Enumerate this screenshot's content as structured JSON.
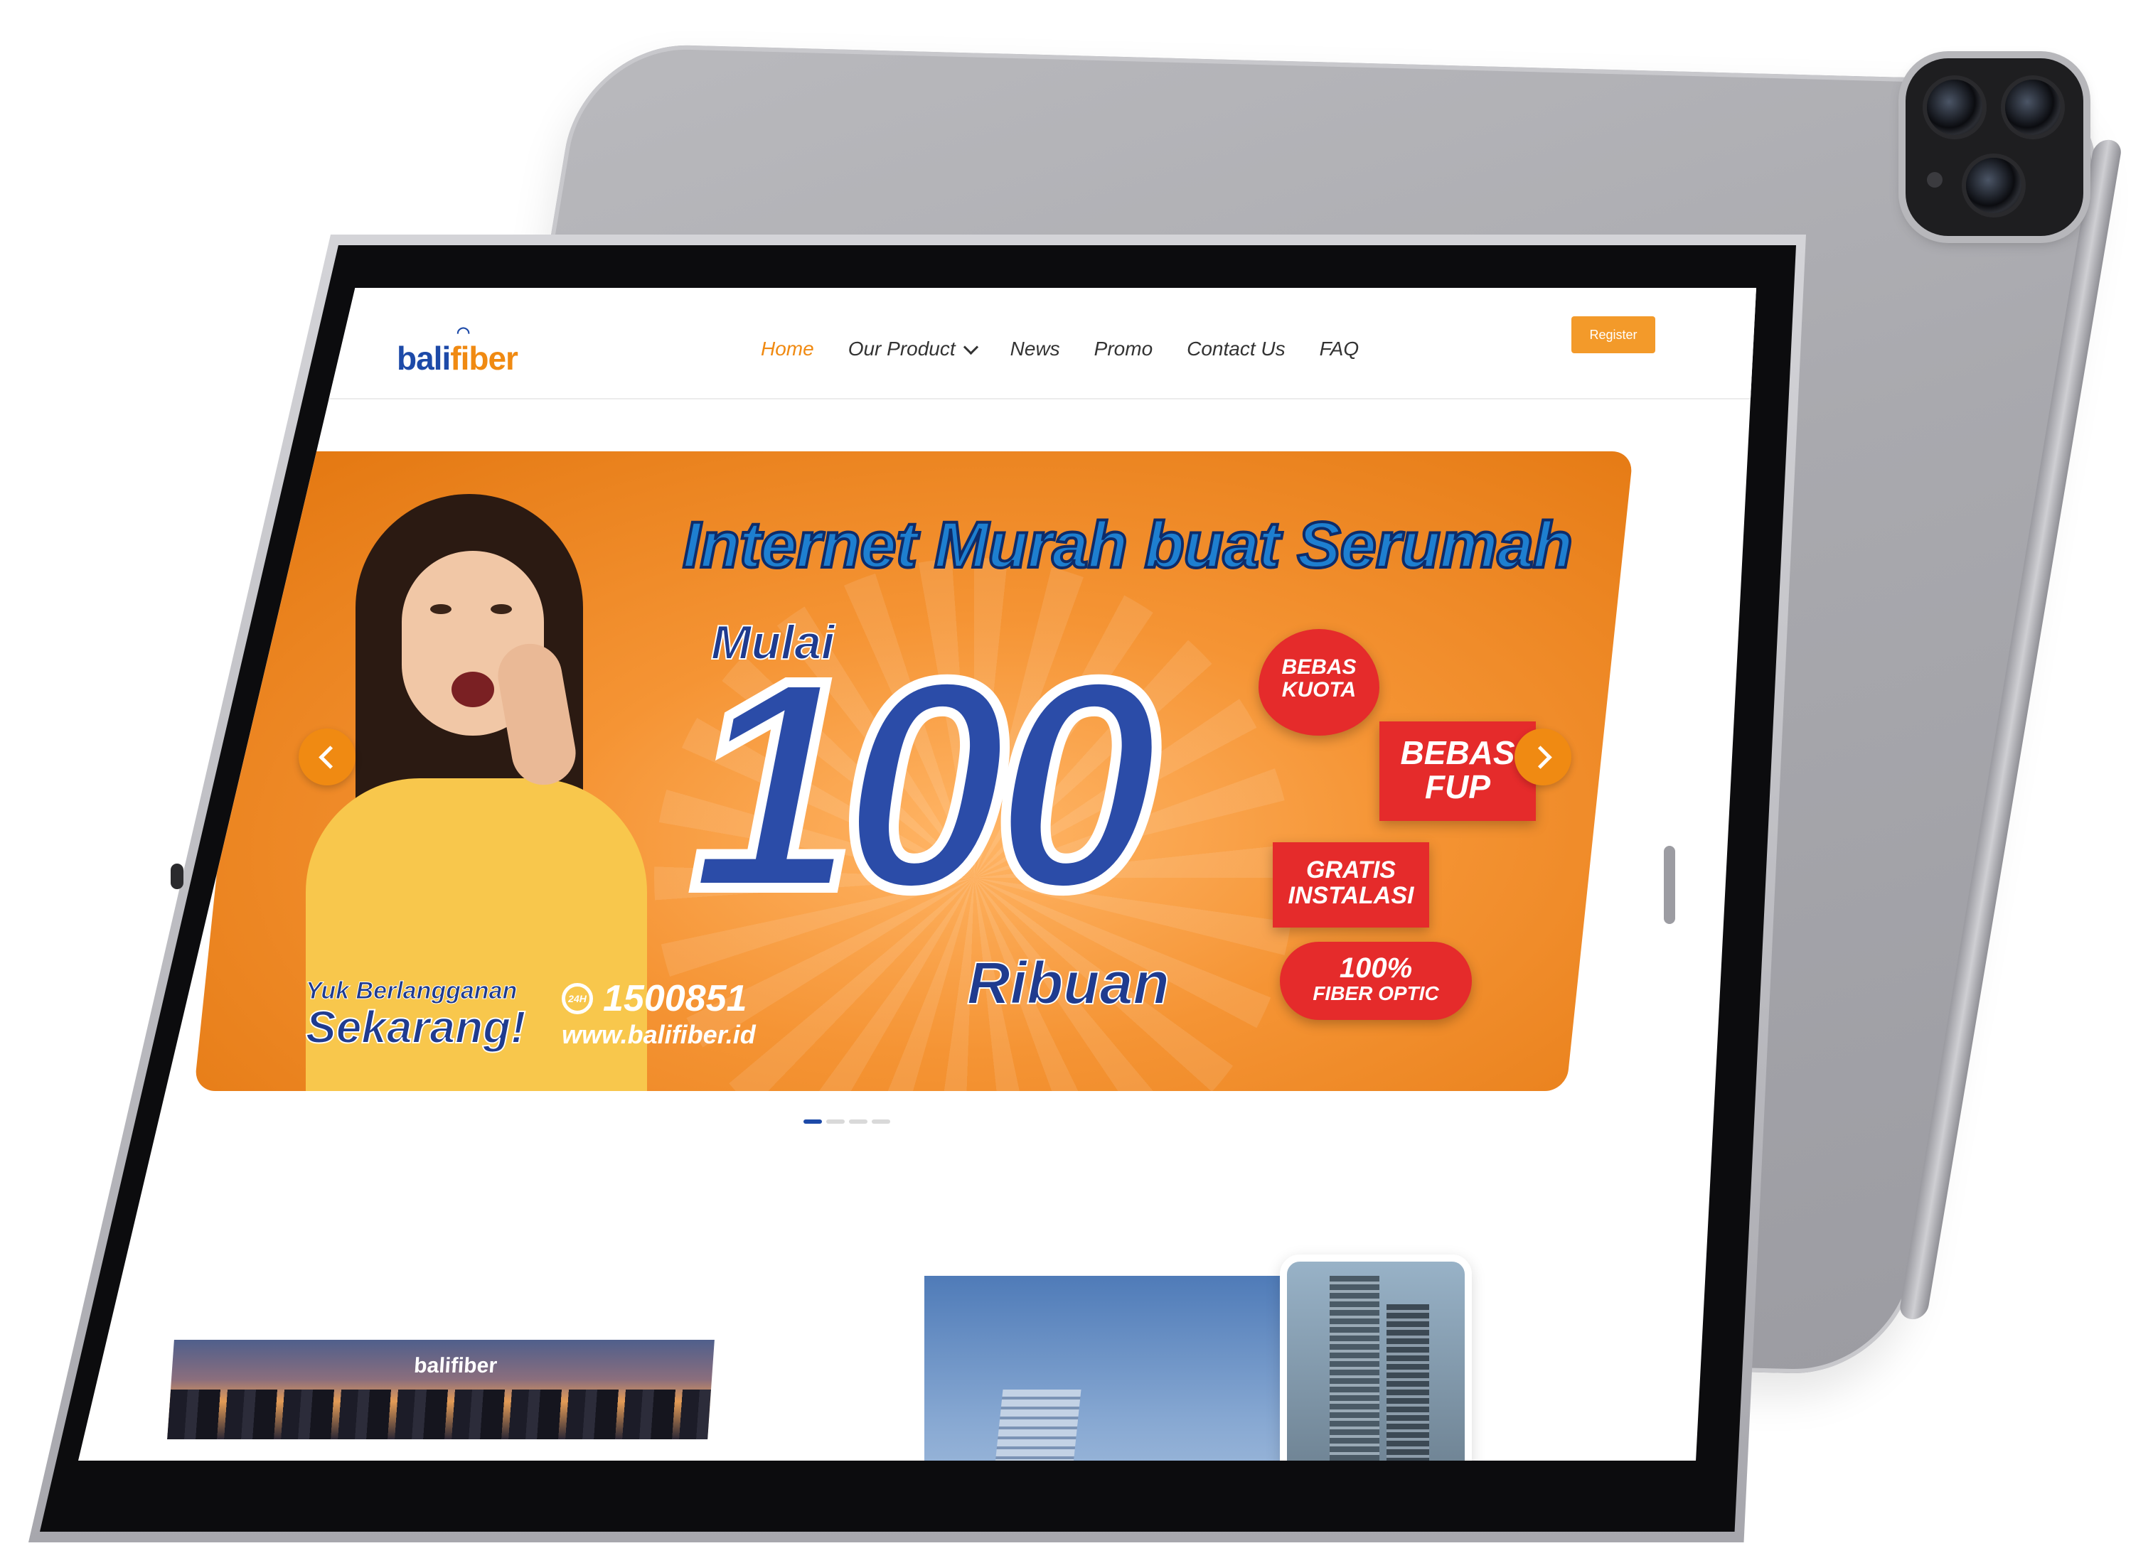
{
  "header": {
    "logo": {
      "part1": "bali",
      "part2": "fiber"
    },
    "nav": [
      {
        "label": "Home",
        "active": true
      },
      {
        "label": "Our Product",
        "dropdown": true
      },
      {
        "label": "News"
      },
      {
        "label": "Promo"
      },
      {
        "label": "Contact Us"
      },
      {
        "label": "FAQ"
      }
    ],
    "register_label": "Register"
  },
  "banner": {
    "headline": "Internet Murah buat Serumah",
    "prefix": "Mulai",
    "big_number": "100",
    "suffix": "Ribuan",
    "stickers": [
      {
        "line1": "BEBAS",
        "line2": "KUOTA"
      },
      {
        "line1": "BEBAS",
        "line2": "FUP"
      },
      {
        "line1": "GRATIS",
        "line2": "INSTALASI"
      },
      {
        "line1": "100%",
        "line2": "FIBER OPTIC"
      }
    ],
    "cta_small": "Yuk Berlangganan",
    "cta_large": "Sekarang!",
    "headset_badge": "24H",
    "phone": "1500851",
    "url": "www.balifiber.id"
  },
  "carousel": {
    "slide_count": 4,
    "active_index": 0
  },
  "lower": {
    "city_brand": "balifiber"
  },
  "colors": {
    "brand_blue": "#1d4aa8",
    "brand_orange": "#f08a12"
  },
  "icons": {
    "prev": "chevron-left-icon",
    "next": "chevron-right-icon",
    "dropdown": "chevron-down-icon",
    "headset": "headset-icon"
  }
}
